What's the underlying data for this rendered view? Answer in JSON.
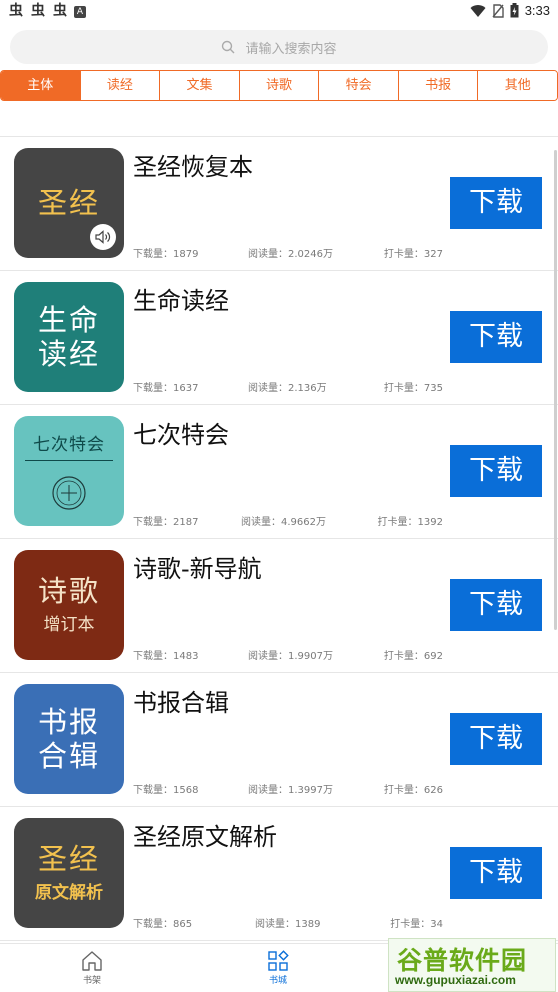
{
  "status_bar": {
    "notif_glyphs": [
      "虫",
      "虫",
      "虫"
    ],
    "notif_a": "A",
    "time": "3:33",
    "icons": [
      "wifi-icon",
      "no-sim-icon",
      "battery-icon"
    ]
  },
  "search": {
    "placeholder": "请输入搜索内容"
  },
  "tabs": [
    {
      "label": "主体",
      "active": true
    },
    {
      "label": "读经"
    },
    {
      "label": "文集"
    },
    {
      "label": "诗歌"
    },
    {
      "label": "特会"
    },
    {
      "label": "书报"
    },
    {
      "label": "其他"
    }
  ],
  "books": [
    {
      "title": "圣经恢复本",
      "cover": {
        "big": "圣经",
        "small": "",
        "bg": "#454545",
        "fg": "#f2c14e",
        "small_fg": "#f2c14e",
        "audio": true
      },
      "downloads": "下载量：1879",
      "reads": "阅读量：2.0246万",
      "checkins": "打卡量：327",
      "button": "下载"
    },
    {
      "title": "生命读经",
      "cover": {
        "big": "生命\n读经",
        "small": "",
        "bg": "#1f7f79",
        "fg": "#ffffff",
        "small_fg": "#ffffff"
      },
      "downloads": "下载量：1637",
      "reads": "阅读量：2.136万",
      "checkins": "打卡量：735",
      "button": "下载"
    },
    {
      "title": "七次特会",
      "cover": {
        "big": "七次特会",
        "small": "",
        "bg": "#67c3bf",
        "fg": "#0f4a4a",
        "small_fg": "#0f4a4a",
        "seal": true
      },
      "downloads": "下载量：2187",
      "reads": "阅读量：4.9662万",
      "checkins": "打卡量：1392",
      "button": "下载"
    },
    {
      "title": "诗歌-新导航",
      "cover": {
        "big": "诗歌",
        "small": "增订本",
        "bg": "#7e2a14",
        "fg": "#f5e3c8",
        "small_fg": "#f5e3c8"
      },
      "downloads": "下载量：1483",
      "reads": "阅读量：1.9907万",
      "checkins": "打卡量：692",
      "button": "下载"
    },
    {
      "title": "书报合辑",
      "cover": {
        "big": "书报\n合辑",
        "small": "",
        "bg": "#3a6fb6",
        "fg": "#ffffff",
        "small_fg": "#ffffff"
      },
      "downloads": "下载量：1568",
      "reads": "阅读量：1.3997万",
      "checkins": "打卡量：626",
      "button": "下载"
    },
    {
      "title": "圣经原文解析",
      "cover": {
        "big": "圣经",
        "small": "原文解析",
        "bg": "#454545",
        "fg": "#f2c14e",
        "small_fg": "#f2c14e"
      },
      "downloads": "下载量：865",
      "reads": "阅读量：1389",
      "checkins": "打卡量：34",
      "button": "下载"
    }
  ],
  "bottom_nav": [
    {
      "label": "书架",
      "icon": "home-icon"
    },
    {
      "label": "书城",
      "icon": "store-grid-icon",
      "active": true
    }
  ],
  "watermark": {
    "main": "谷普软件园",
    "url": "www.gupuxiazai.com"
  },
  "colors": {
    "accent": "#f06a26",
    "button": "#0a6ed8",
    "active_nav": "#0a6ed8"
  }
}
